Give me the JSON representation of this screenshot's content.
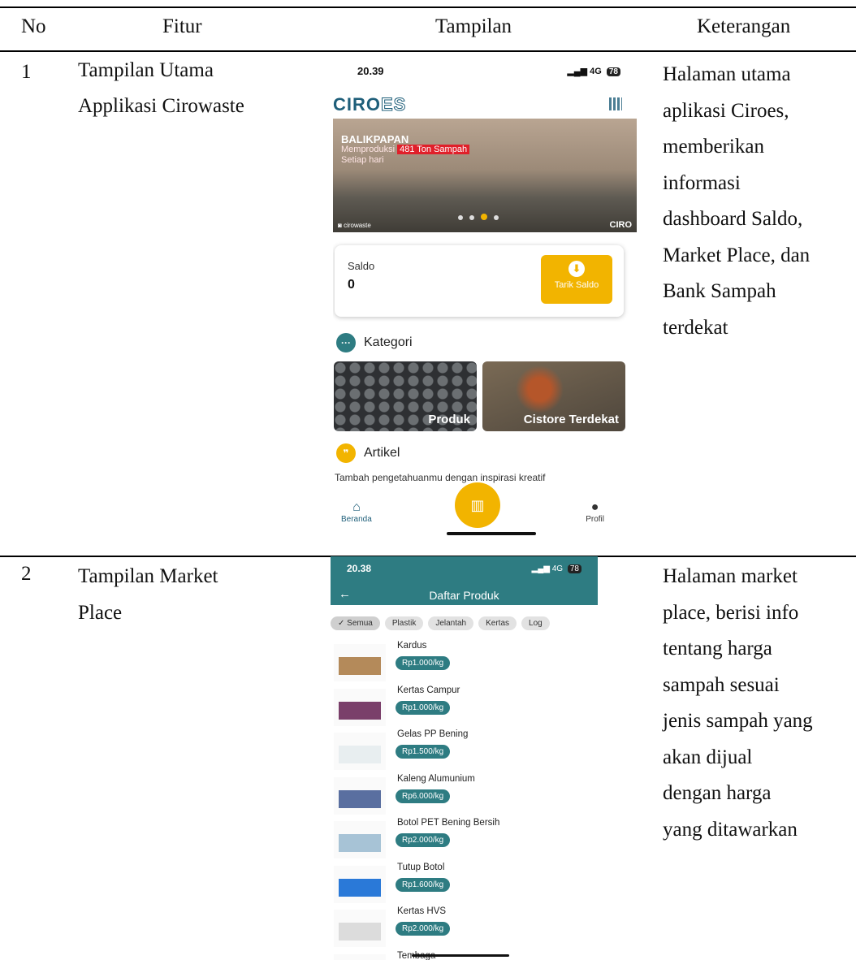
{
  "table": {
    "headers": {
      "no": "No",
      "fitur": "Fitur",
      "tampilan": "Tampilan",
      "keterangan": "Keterangan"
    },
    "rows": [
      {
        "no": "1",
        "fitur_lines": [
          "Tampilan Utama",
          "Applikasi Cirowaste"
        ],
        "keterangan_lines": [
          "Halaman utama",
          "aplikasi Ciroes,",
          "memberikan",
          "informasi",
          "dashboard Saldo,",
          "Market Place, dan",
          "Bank Sampah",
          "terdekat"
        ]
      },
      {
        "no": "2",
        "fitur_lines": [
          "Tampilan Market",
          "Place"
        ],
        "keterangan_lines": [
          "Halaman market",
          "place, berisi info",
          "tentang harga",
          "sampah sesuai",
          "jenis sampah yang",
          "akan dijual",
          "dengan harga",
          "yang ditawarkan"
        ]
      }
    ]
  },
  "screen_home": {
    "time": "20.39",
    "signal": "4G",
    "battery": "78",
    "logo_main": "CIRO",
    "logo_suffix": "ES",
    "banner": {
      "city": "BALIKPAPAN",
      "line2_prefix": "Memproduksi",
      "line2_highlight": "481 Ton Sampah",
      "line3": "Setiap hari",
      "instagram": "cirowaste",
      "brand": "CIRO"
    },
    "saldo": {
      "label": "Saldo",
      "value": "0",
      "button": "Tarik Saldo"
    },
    "kategori_title": "Kategori",
    "tiles": [
      "Produk",
      "Cistore Terdekat"
    ],
    "artikel_title": "Artikel",
    "artikel_text": "Tambah pengetahuanmu dengan inspirasi kreatif",
    "nav": {
      "home": "Beranda",
      "profile": "Profil"
    }
  },
  "screen_market": {
    "time": "20.38",
    "signal": "4G",
    "battery": "78",
    "title": "Daftar Produk",
    "chips": [
      "Semua",
      "Plastik",
      "Jelantah",
      "Kertas",
      "Log"
    ],
    "products": [
      {
        "name": "Kardus",
        "price": "Rp1.000/kg",
        "color": "#b48a5a"
      },
      {
        "name": "Kertas Campur",
        "price": "Rp1.000/kg",
        "color": "#7a3f6a"
      },
      {
        "name": "Gelas PP Bening",
        "price": "Rp1.500/kg",
        "color": "#e8eef0"
      },
      {
        "name": "Kaleng Alumunium",
        "price": "Rp6.000/kg",
        "color": "#5a6fa0"
      },
      {
        "name": "Botol PET Bening Bersih",
        "price": "Rp2.000/kg",
        "color": "#a7c3d6"
      },
      {
        "name": "Tutup Botol",
        "price": "Rp1.600/kg",
        "color": "#2a79d8"
      },
      {
        "name": "Kertas HVS",
        "price": "Rp2.000/kg",
        "color": "#dcdcdc"
      },
      {
        "name": "Tembaga",
        "price": "",
        "color": "#b45a2a"
      }
    ]
  }
}
